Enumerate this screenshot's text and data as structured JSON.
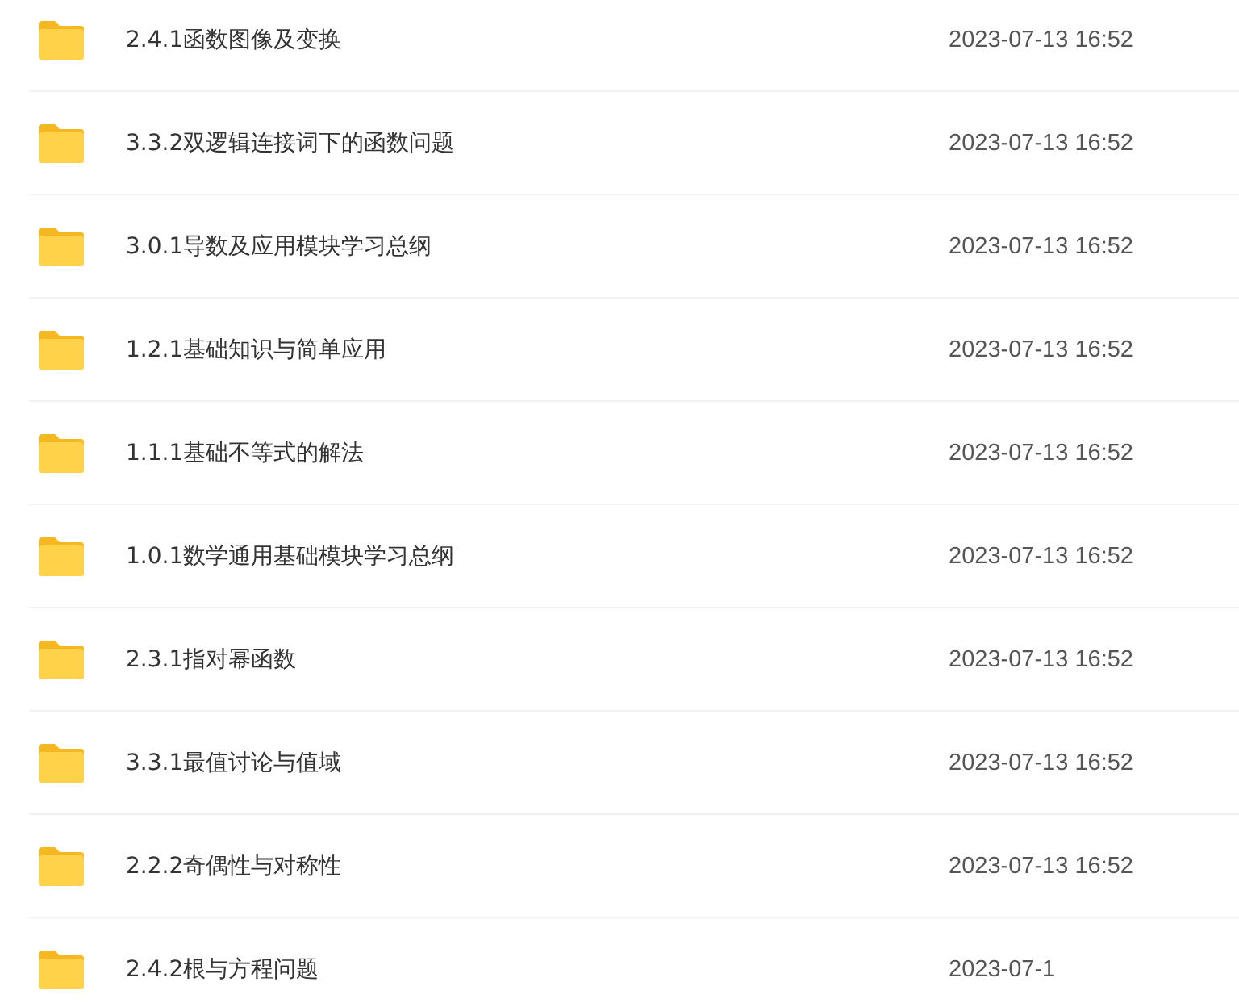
{
  "files": [
    {
      "name": "2.4.1函数图像及变换",
      "modified": "2023-07-13 16:52"
    },
    {
      "name": "3.3.2双逻辑连接词下的函数问题",
      "modified": "2023-07-13 16:52"
    },
    {
      "name": "3.0.1导数及应用模块学习总纲",
      "modified": "2023-07-13 16:52"
    },
    {
      "name": "1.2.1基础知识与简单应用",
      "modified": "2023-07-13 16:52"
    },
    {
      "name": "1.1.1基础不等式的解法",
      "modified": "2023-07-13 16:52"
    },
    {
      "name": "1.0.1数学通用基础模块学习总纲",
      "modified": "2023-07-13 16:52"
    },
    {
      "name": "2.3.1指对幂函数",
      "modified": "2023-07-13 16:52"
    },
    {
      "name": "3.3.1最值讨论与值域",
      "modified": "2023-07-13 16:52"
    },
    {
      "name": "2.2.2奇偶性与对称性",
      "modified": "2023-07-13 16:52"
    },
    {
      "name": "2.4.2根与方程问题",
      "modified": "2023-07-1"
    }
  ]
}
